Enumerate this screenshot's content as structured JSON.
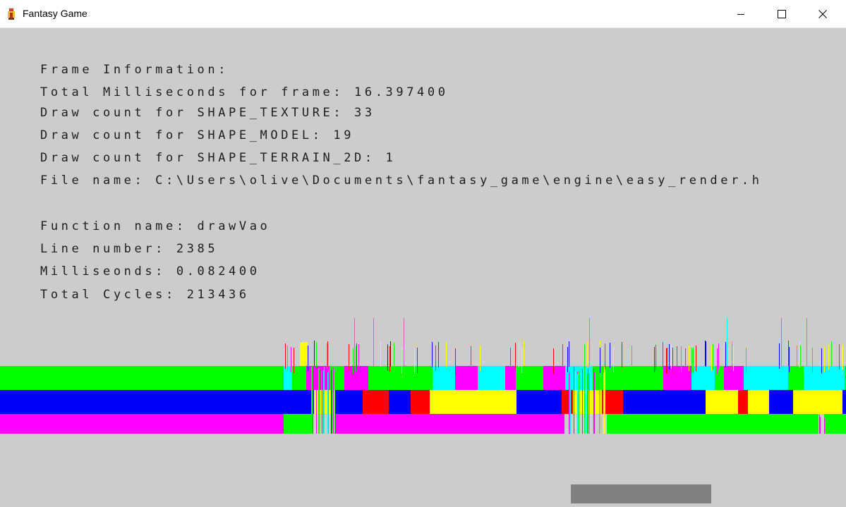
{
  "window": {
    "title": "Fantasy Game",
    "app_icon": "game-app-icon",
    "controls": [
      "minimize-icon",
      "maximize-icon",
      "close-icon"
    ]
  },
  "frame_info": {
    "heading": "Frame Information:",
    "total_ms": "Total Milliseconds for frame: 16.397400",
    "draw_texture": "Draw count for SHAPE_TEXTURE: 33",
    "draw_model": "Draw count for SHAPE_MODEL: 19",
    "draw_terrain": "Draw count for SHAPE_TERRAIN_2D: 1",
    "file_name": "File name: C:\\Users\\olive\\Documents\\fantasy_game\\engine\\easy_render.h"
  },
  "function_info": {
    "function_name": "Function name: drawVao",
    "line_number": "Line number: 2385",
    "milliseconds": "Milliseonds: 0.082400",
    "total_cycles": "Total Cycles: 213436"
  },
  "profiler_colors": {
    "green": "#00ff00",
    "blue": "#0000ff",
    "magenta": "#ff00ff",
    "yellow": "#ffff00",
    "cyan": "#00ffff",
    "red": "#ff0000",
    "background": "#cccccc",
    "progress": "#808080"
  }
}
